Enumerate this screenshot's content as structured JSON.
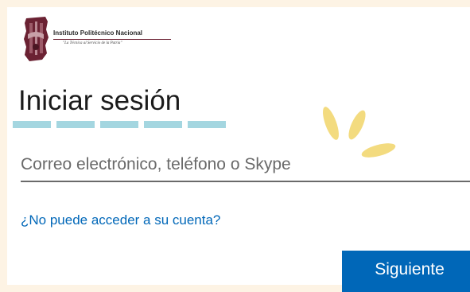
{
  "logo": {
    "name": "Instituto Politécnico Nacional",
    "motto": "\"La Técnica al Servicio de la Patria\""
  },
  "signin": {
    "title": "Iniciar sesión",
    "email_placeholder": "Correo electrónico, teléfono o Skype",
    "email_value": "",
    "help_link": "¿No puede acceder a su cuenta?",
    "next_label": "Siguiente"
  },
  "colors": {
    "accent": "#0067b8",
    "page_background": "#fdf3e4",
    "dash_decoration": "#a4d6e0",
    "sparkle_decoration": "#f3db7f",
    "logo_maroon": "#6b2233"
  },
  "icons": {
    "logo_emblem": "ipn-emblem-icon",
    "sparkle": "sparkle-icon"
  }
}
